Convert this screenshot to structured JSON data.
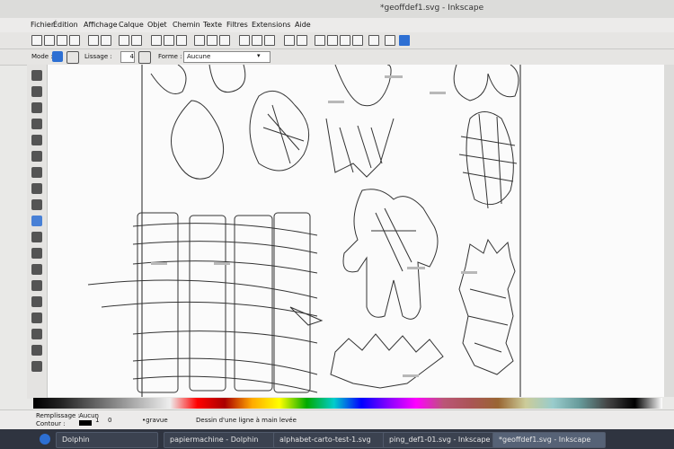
{
  "window": {
    "title": "*geoffdef1.svg - Inkscape"
  },
  "menu": [
    "Fichier",
    "Édition",
    "Affichage",
    "Calque",
    "Objet",
    "Chemin",
    "Texte",
    "Filtres",
    "Extensions",
    "Aide"
  ],
  "tool_controls": {
    "mode_label": "Mode :",
    "lissage_label": "Lissage :",
    "lissage_value": "4",
    "forme_label": "Forme :",
    "forme_value": "Aucune"
  },
  "status": {
    "fill_label": "Remplissage :",
    "fill_value": "Aucun",
    "stroke_label": "Contour :",
    "stroke_width": "1",
    "opacity": "0",
    "layer": "•gravue",
    "message": "Dessin d'une ligne à main levée"
  },
  "taskbar": {
    "items": [
      {
        "label": "Dolphin"
      },
      {
        "label": "papiermachine - Dolphin"
      },
      {
        "label": "alphabet-carto-test-1.svg"
      },
      {
        "label": "ping_def1-01.svg - Inkscape"
      },
      {
        "label": "*geoffdef1.svg - Inkscape"
      }
    ]
  },
  "colors": {
    "accent": "#2d6fd3",
    "taskbar": "#2f3440",
    "canvas": "#fbfbfb"
  }
}
